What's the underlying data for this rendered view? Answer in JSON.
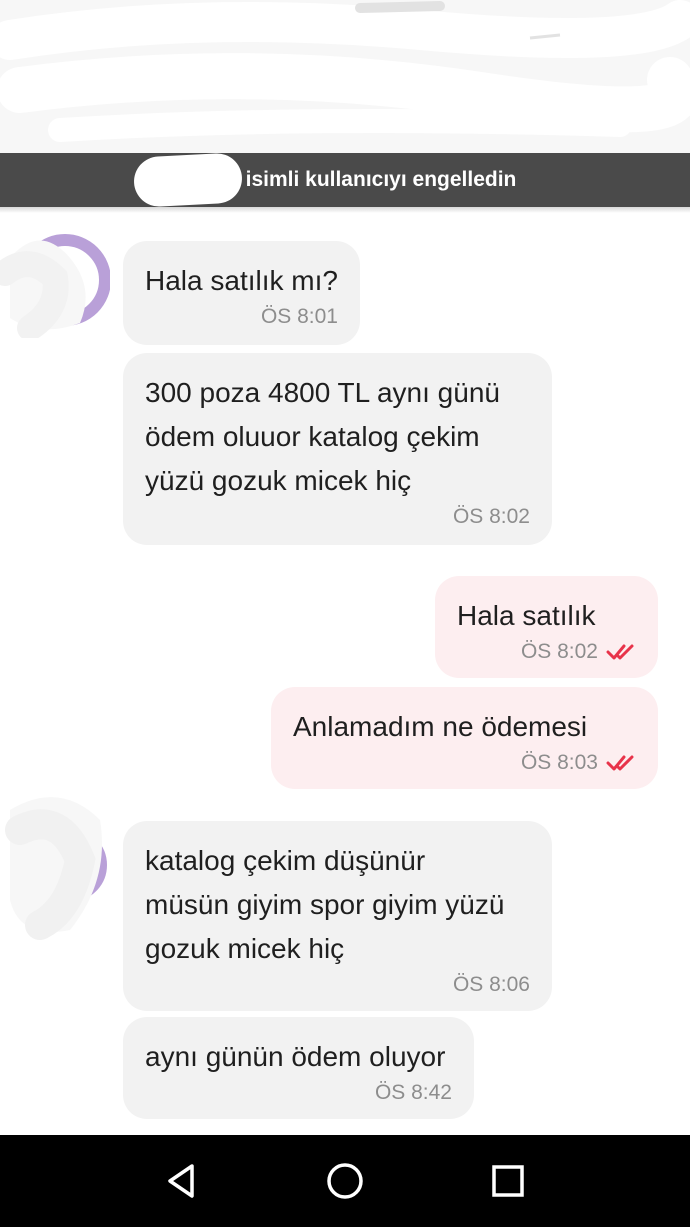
{
  "banner": {
    "text": "isimli kullanıcıyı engelledin"
  },
  "messages": [
    {
      "direction": "in",
      "text": "Hala satılık mı?",
      "time": "ÖS 8:01"
    },
    {
      "direction": "in",
      "text": "300 poza 4800 TL aynı günü\nödem oluuor katalog çekim\nyüzü gozuk micek hiç",
      "time": "ÖS 8:02"
    },
    {
      "direction": "out",
      "text": "Hala satılık",
      "time": "ÖS 8:02",
      "status": "double-check-icon"
    },
    {
      "direction": "out",
      "text": "Anlamadım ne ödemesi",
      "time": "ÖS 8:03",
      "status": "double-check-icon"
    },
    {
      "direction": "in",
      "text": "katalog çekim düşünür\nmüsün giyim spor giyim yüzü\ngozuk micek hiç",
      "time": "ÖS 8:06"
    },
    {
      "direction": "in",
      "text": "aynı günün ödem oluyor",
      "time": "ÖS 8:42"
    }
  ],
  "colors": {
    "incoming_bubble": "#f2f2f2",
    "outgoing_bubble": "#fdeef0",
    "read_ticks": "#e8334a",
    "banner": "#4a4a4a",
    "avatar_accent": "#b9a0d8"
  },
  "navbar": {
    "icons": [
      "back-triangle-icon",
      "home-circle-icon",
      "recents-square-icon"
    ]
  }
}
